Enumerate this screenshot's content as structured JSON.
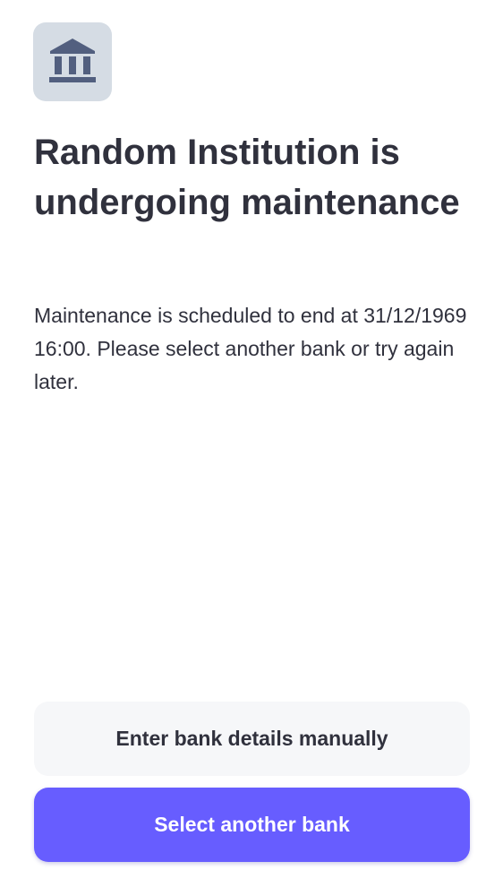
{
  "institution": {
    "icon": "bank-icon",
    "icon_color": "#525f7f",
    "icon_bg_color": "#d5dce4"
  },
  "maintenance": {
    "title": "Random Institution is undergoing maintenance",
    "message": "Maintenance is scheduled to end at 31/12/1969 16:00. Please select another bank or try again later."
  },
  "actions": {
    "manual_label": "Enter bank details manually",
    "select_other_label": "Select another bank",
    "primary_color": "#675dff",
    "secondary_color": "#f6f7f9"
  }
}
